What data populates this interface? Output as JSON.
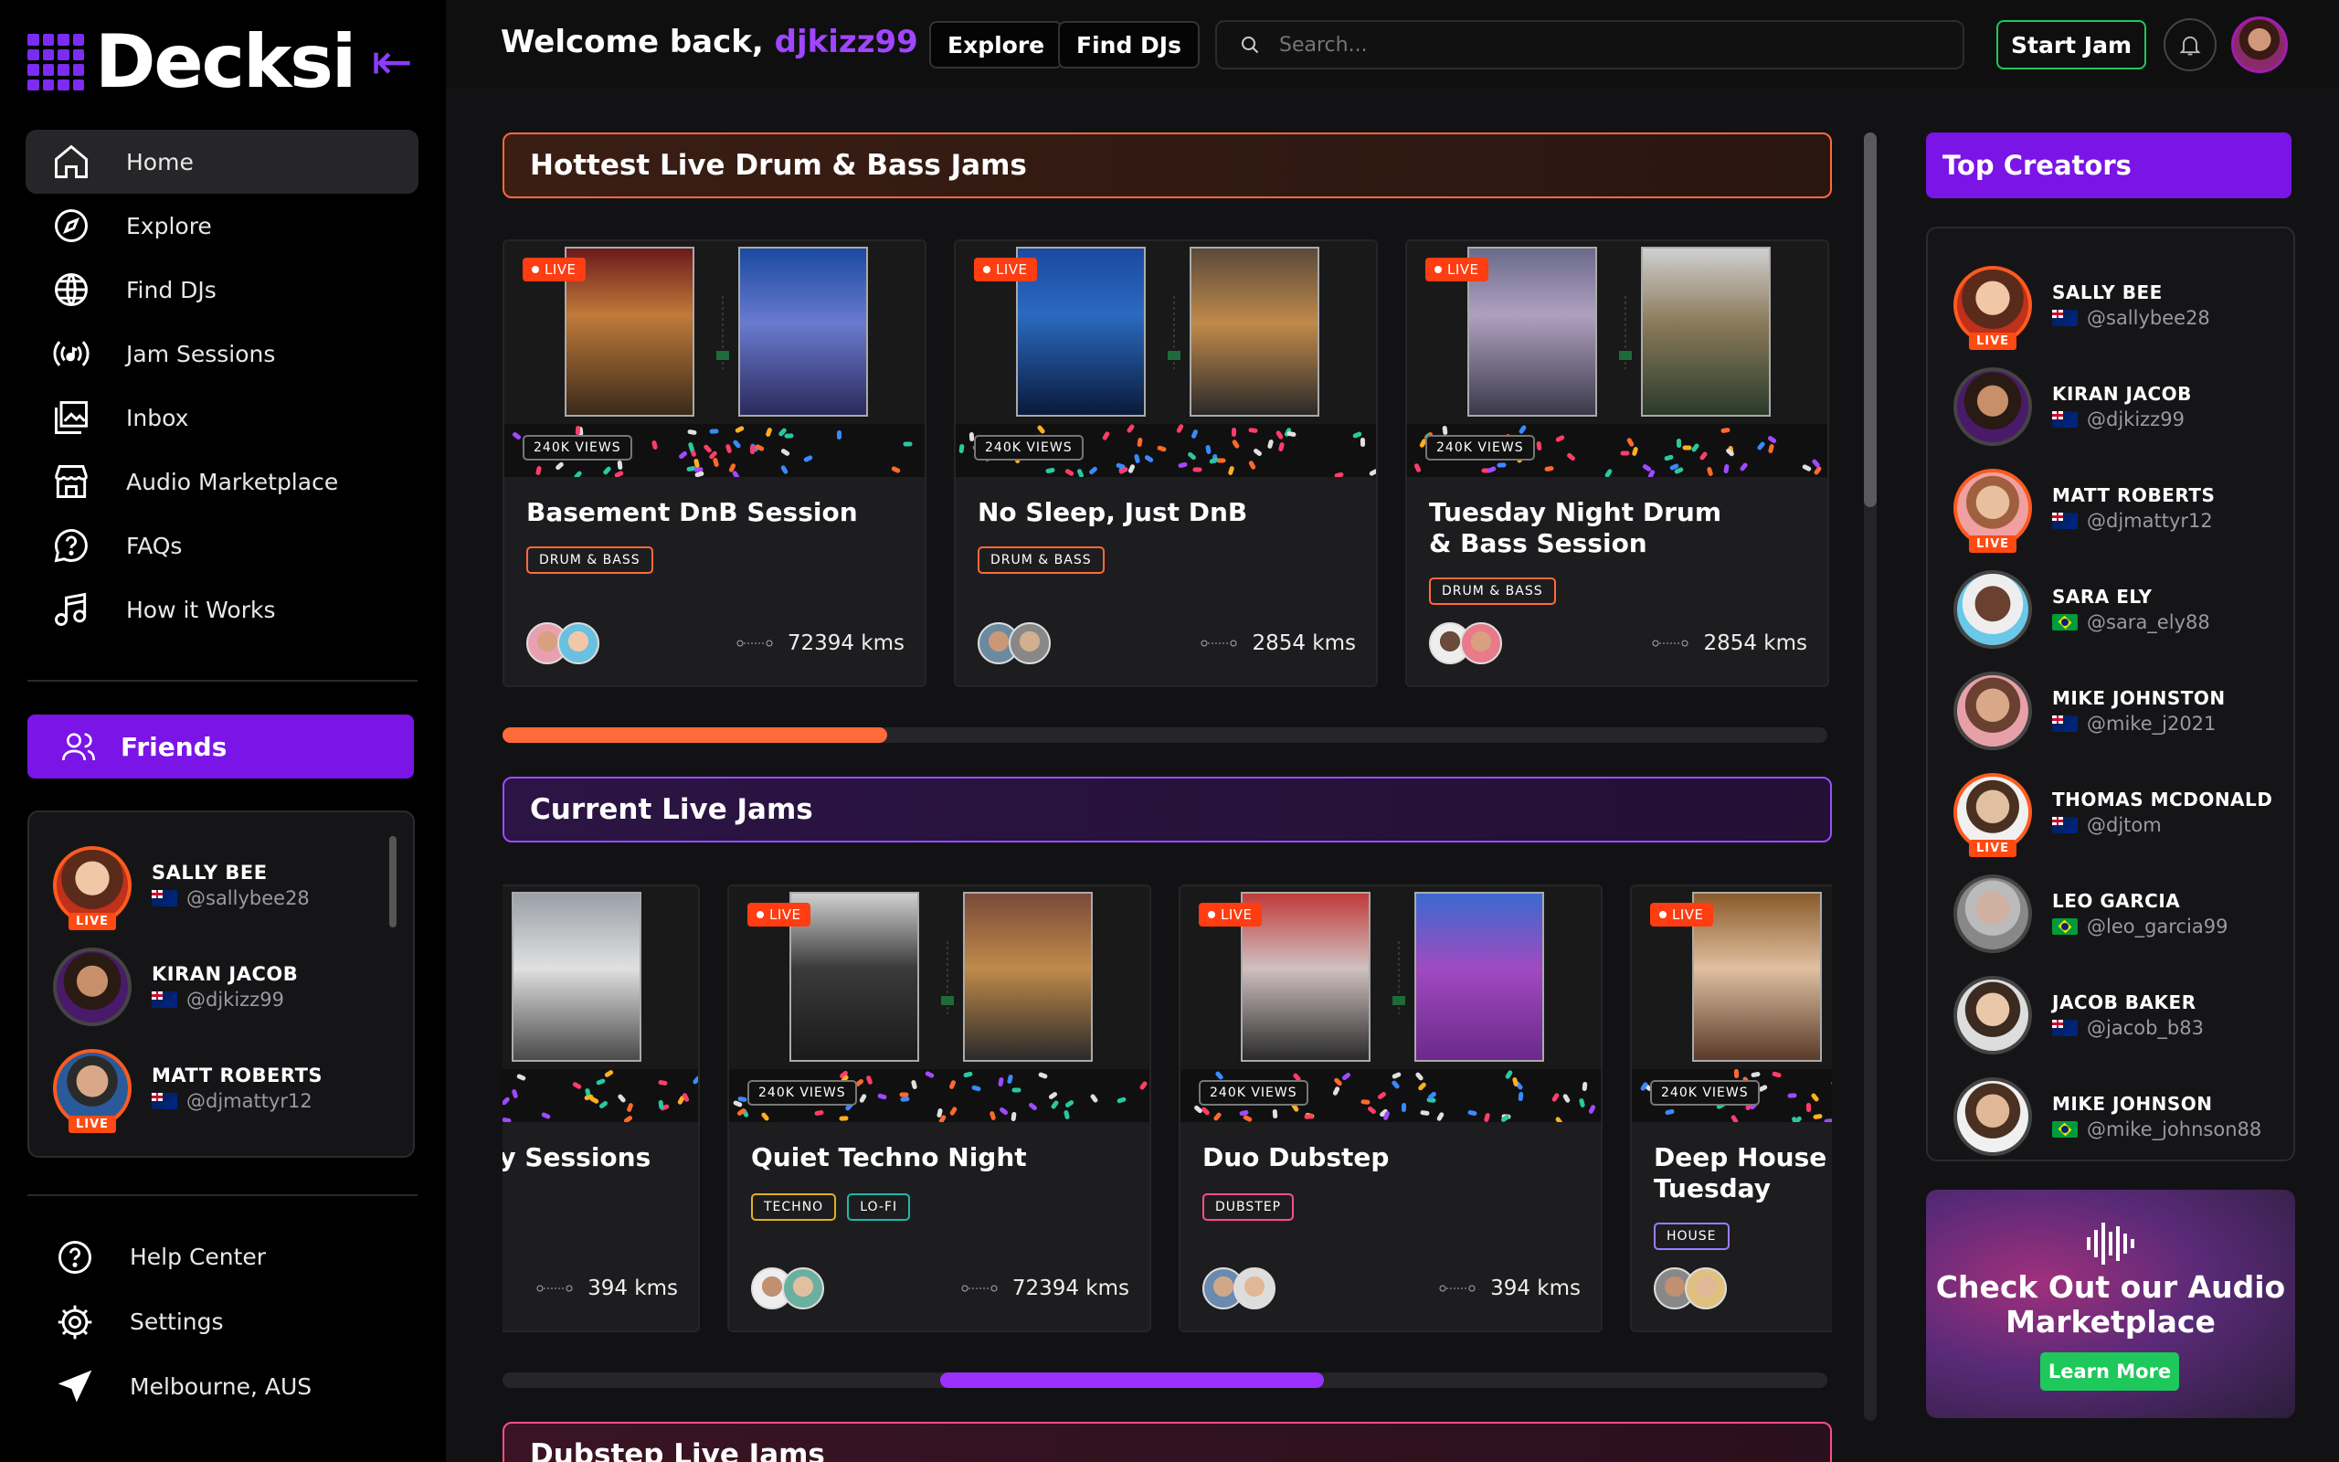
{
  "brand": {
    "name": "Decksi"
  },
  "sidebar": {
    "nav": [
      {
        "label": "Home",
        "icon": "home-icon"
      },
      {
        "label": "Explore",
        "icon": "compass-icon"
      },
      {
        "label": "Find DJs",
        "icon": "globe-icon"
      },
      {
        "label": "Jam Sessions",
        "icon": "broadcast-icon"
      },
      {
        "label": "Inbox",
        "icon": "inbox-icon"
      },
      {
        "label": "Audio Marketplace",
        "icon": "store-icon"
      },
      {
        "label": "FAQs",
        "icon": "question-icon"
      },
      {
        "label": "How it Works",
        "icon": "music-note-icon"
      }
    ],
    "friends_label": "Friends",
    "friends": [
      {
        "name": "SALLY BEE",
        "handle": "@sallybee28",
        "flag": "au",
        "live": true
      },
      {
        "name": "KIRAN JACOB",
        "handle": "@djkizz99",
        "flag": "au",
        "live": false
      },
      {
        "name": "MATT ROBERTS",
        "handle": "@djmattyr12",
        "flag": "au",
        "live": true
      }
    ],
    "bottom": [
      {
        "label": "Help Center",
        "icon": "help-icon"
      },
      {
        "label": "Settings",
        "icon": "gear-icon"
      },
      {
        "label": "Melbourne, AUS",
        "icon": "location-arrow-icon"
      }
    ],
    "live_label": "LIVE"
  },
  "header": {
    "welcome": "Welcome back, ",
    "username": "djkizz99",
    "explore": "Explore",
    "find_djs": "Find DJs",
    "search_placeholder": "Search...",
    "start_jam": "Start Jam"
  },
  "sections": {
    "dnb": {
      "title": "Hottest Live Drum & Bass Jams",
      "progress": 0.29,
      "cards": [
        {
          "title": "Basement DnB Session",
          "tags": [
            "DRUM & BASS"
          ],
          "views": "240K VIEWS",
          "distance": "72394 kms",
          "live": true
        },
        {
          "title": "No Sleep, Just DnB",
          "tags": [
            "DRUM & BASS"
          ],
          "views": "240K VIEWS",
          "distance": "2854 kms",
          "live": true
        },
        {
          "title": "Tuesday Night Drum & Bass Session",
          "tags": [
            "DRUM & BASS"
          ],
          "views": "240K VIEWS",
          "distance": "2854 kms",
          "live": true
        }
      ]
    },
    "current": {
      "title": "Current Live Jams",
      "progress_start": 0.33,
      "progress_end": 0.62,
      "cards": [
        {
          "title": "Low Frequency Sessions",
          "tags": [],
          "views": "",
          "distance": "394 kms",
          "live": false
        },
        {
          "title": "Quiet Techno Night",
          "tags": [
            "TECHNO",
            "LO-FI"
          ],
          "views": "240K VIEWS",
          "distance": "72394 kms",
          "live": true
        },
        {
          "title": "Duo Dubstep",
          "tags": [
            "DUBSTEP"
          ],
          "views": "240K VIEWS",
          "distance": "394 kms",
          "live": true
        },
        {
          "title": "Deep House Tuesday",
          "tags": [
            "HOUSE"
          ],
          "views": "240K VIEWS",
          "distance": "",
          "live": true
        }
      ]
    },
    "dubstep": {
      "title": "Dubstep Live Jams"
    }
  },
  "top_creators": {
    "title": "Top Creators",
    "list": [
      {
        "name": "SALLY BEE",
        "handle": "@sallybee28",
        "flag": "au",
        "live": true
      },
      {
        "name": "KIRAN JACOB",
        "handle": "@djkizz99",
        "flag": "au",
        "live": false
      },
      {
        "name": "MATT ROBERTS",
        "handle": "@djmattyr12",
        "flag": "au",
        "live": true
      },
      {
        "name": "SARA ELY",
        "handle": "@sara_ely88",
        "flag": "br",
        "live": false
      },
      {
        "name": "MIKE JOHNSTON",
        "handle": "@mike_j2021",
        "flag": "au",
        "live": false
      },
      {
        "name": "THOMAS MCDONALD",
        "handle": "@djtom",
        "flag": "au",
        "live": true
      },
      {
        "name": "LEO GARCIA",
        "handle": "@leo_garcia99",
        "flag": "br",
        "live": false
      },
      {
        "name": "JACOB BAKER",
        "handle": "@jacob_b83",
        "flag": "au",
        "live": false
      },
      {
        "name": "MIKE JOHNSON",
        "handle": "@mike_johnson88",
        "flag": "br",
        "live": false
      }
    ]
  },
  "promo": {
    "title": "Check Out our Audio Marketplace",
    "button": "Learn More"
  },
  "colors": {
    "accent": "#7b14e6",
    "live": "#ff4a12",
    "orange": "#ff6a3a",
    "green": "#1ec85a"
  }
}
